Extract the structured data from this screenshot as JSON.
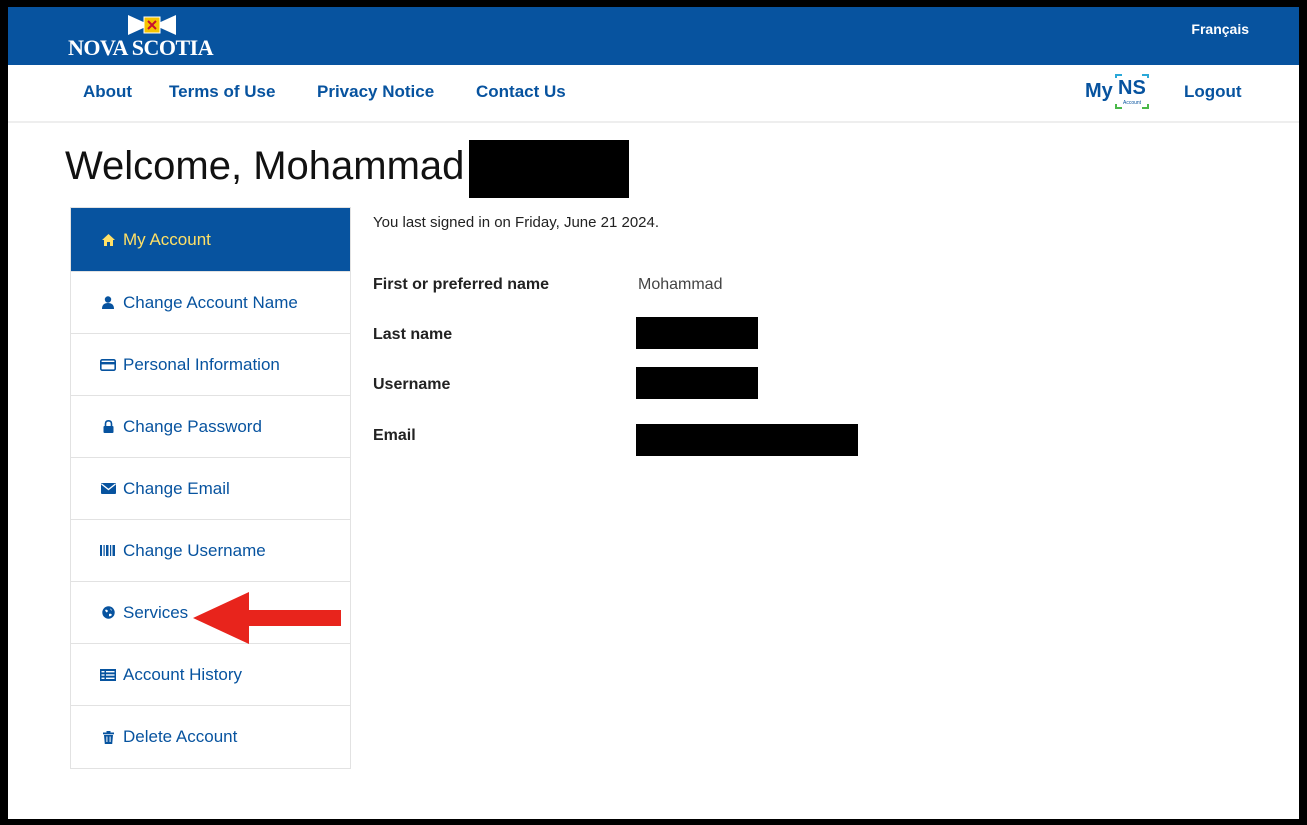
{
  "header": {
    "logo_text": "NOVA SCOTIA",
    "language_link": "Français"
  },
  "nav": {
    "links": [
      "About",
      "Terms of Use",
      "Privacy Notice",
      "Contact Us"
    ],
    "myns_my": "My",
    "myns_ns": "NS",
    "myns_sub": "Account",
    "logout": "Logout"
  },
  "page": {
    "welcome": "Welcome, Mohammad",
    "last_signed_in": "You last signed in on Friday, June 21 2024."
  },
  "sidebar": {
    "items": [
      {
        "label": "My Account",
        "icon": "home-icon",
        "active": true
      },
      {
        "label": "Change Account Name",
        "icon": "user-icon",
        "active": false
      },
      {
        "label": "Personal Information",
        "icon": "card-icon",
        "active": false
      },
      {
        "label": "Change Password",
        "icon": "lock-icon",
        "active": false
      },
      {
        "label": "Change Email",
        "icon": "envelope-icon",
        "active": false
      },
      {
        "label": "Change Username",
        "icon": "barcode-icon",
        "active": false
      },
      {
        "label": "Services",
        "icon": "globe-icon",
        "active": false
      },
      {
        "label": "Account History",
        "icon": "list-icon",
        "active": false
      },
      {
        "label": "Delete Account",
        "icon": "trash-icon",
        "active": false
      }
    ]
  },
  "account": {
    "first_name_label": "First or preferred name",
    "first_name_value": "Mohammad",
    "last_name_label": "Last name",
    "username_label": "Username",
    "email_label": "Email"
  },
  "colors": {
    "brand_blue": "#07539f",
    "active_text": "#ffe066",
    "annotation_arrow": "#e8241c"
  }
}
